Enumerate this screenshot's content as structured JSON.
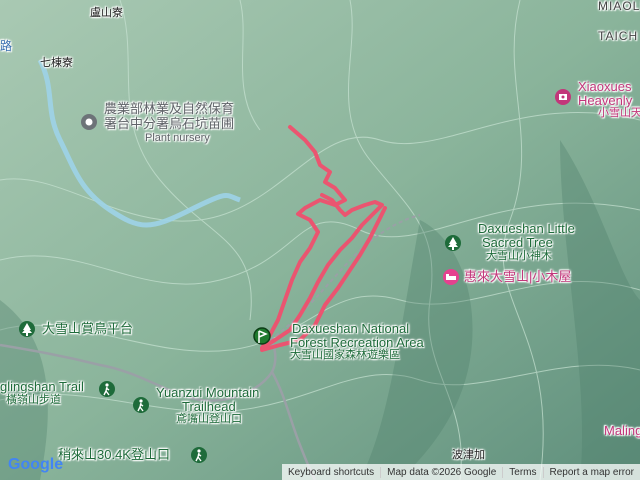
{
  "places": {
    "lushanliao": "盧山寮",
    "qidongliao": "七棟寮",
    "edge_lu": "路",
    "miaoli": "MIAOLI",
    "taichung": "TAICH",
    "bogongjia": "波津加"
  },
  "pois": {
    "nursery_zh_1": "農業部林業及自然保育",
    "nursery_zh_2": "署台中分署烏石坑苗圃",
    "nursery_en": "Plant nursery",
    "xiaoxue_en_1": "Xiaoxues",
    "xiaoxue_en_2": "Heavenly",
    "xiaoxue_zh": "小雪山天",
    "sacred_en_1": "Daxueshan Little",
    "sacred_en_2": "Sacred Tree",
    "sacred_zh": "大雪山小神木",
    "cabin": "惠來大雪山|小木屋",
    "recarea_en_1": "Daxueshan National",
    "recarea_en_2": "Forest Recreation Area",
    "recarea_zh": "大雪山國家森林遊樂區",
    "birding": "大雪山賞鳥平台",
    "lingling_en": "glingshan Trail",
    "lingling_zh": "橫嶺山步道",
    "yuanzui_en_1": "Yuanzui Mountain",
    "yuanzui_en_2": "Trailhead",
    "yuanzui_zh": "鳶嘴山登山口",
    "shaolai": "稍來山30.4K登山口",
    "maling": "Maling"
  },
  "icons": {
    "nursery": "circle-dot-icon",
    "xiaoxue": "photo-icon",
    "sacred": "tree-icon",
    "cabin": "bed-icon",
    "birding": "tree-icon",
    "lingling": "hiker-icon",
    "yuanzui": "hiker-icon",
    "shaolai": "hiker-icon",
    "start": "green-start-marker-icon"
  },
  "colors": {
    "track": "#f0506e",
    "terrain": "#8fb59f",
    "river": "#9dd3e8",
    "road": "#9aa0a6",
    "green_poi": "#1e6b3a",
    "pink_poi": "#c2367a"
  },
  "attribution": {
    "shortcuts": "Keyboard shortcuts",
    "mapdata": "Map data ©2026 Google",
    "terms": "Terms",
    "report": "Report a map error"
  },
  "logo": "Google"
}
